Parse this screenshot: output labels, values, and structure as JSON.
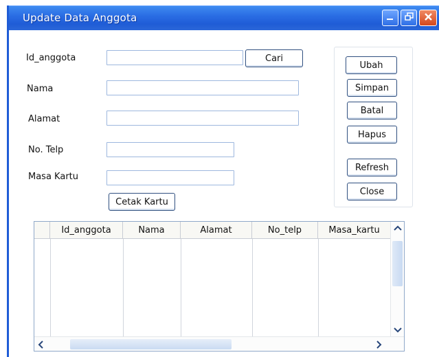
{
  "window": {
    "title": "Update Data Anggota",
    "controls": {
      "minimize_icon": "minimize-icon",
      "maximize_icon": "maximize-icon",
      "close_icon": "close-icon"
    }
  },
  "form": {
    "id_label": "Id_anggota",
    "id_value": "",
    "cari_label": "Cari",
    "nama_label": "Nama",
    "nama_value": "",
    "alamat_label": "Alamat",
    "alamat_value": "",
    "telp_label": "No. Telp",
    "telp_value": "",
    "masa_label": "Masa Kartu",
    "masa_value": "",
    "cetak_label": "Cetak Kartu"
  },
  "actions": {
    "ubah": "Ubah",
    "simpan": "Simpan",
    "batal": "Batal",
    "hapus": "Hapus",
    "refresh": "Refresh",
    "close": "Close"
  },
  "table": {
    "columns": [
      "Id_anggota",
      "Nama",
      "Alamat",
      "No_telp",
      "Masa_kartu"
    ],
    "rows": []
  },
  "colors": {
    "titlebar": "#2a6de4",
    "button_border": "#2f4f7f",
    "field_border": "#9db7de"
  }
}
